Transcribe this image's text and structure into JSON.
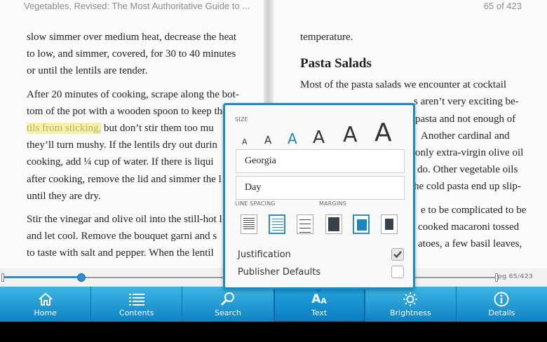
{
  "header": {
    "book_title": "Vegetables, Revised: The Most Authoritative Guide to ...",
    "page_of": "65 of 423"
  },
  "left_page": {
    "lines": [
      "slow simmer over medium heat, decrease the heat",
      "to low, and simmer, covered, for 30 to 40 minutes",
      "or until the lentils are tender.",
      "After 20 minutes of cooking, scrape along the bot-",
      "tom of the pot with a wooden spoon to keep the",
      "but don’t stir them too mu",
      "they’ll turn mushy. If the lentils dry out durin",
      "cooking, add ¼ cup of water. If there is liqui",
      "after cooking, remove the lid and simmer the l",
      "until they are dry.",
      "Stir the vinegar and olive oil into the still-hot l",
      "and let cool. Remove the bouquet garni and s",
      "to taste with salt and pepper. When the lentil"
    ],
    "highlight": "tils from sticking,"
  },
  "right_page": {
    "line1": "temperature.",
    "heading": "Pasta Salads",
    "lines": [
      "Most of the pasta salads we encounter at cocktail",
      "s aren’t very exciting be-",
      "pasta and not enough of",
      "Another cardinal and",
      "only extra-virgin olive oil",
      "do. Other vegetable oils",
      "he cold pasta end up slip-",
      "e to be complicated to be",
      "cooked macaroni tossed",
      "atoes, a few basil leaves,"
    ]
  },
  "progress": {
    "label": "pg 65/423",
    "fraction": 0.155
  },
  "popup": {
    "size_label": "SIZE",
    "size_glyphs": [
      "A",
      "A",
      "A",
      "A",
      "A",
      "A"
    ],
    "selected_size_index": 2,
    "font_value": "Georgia",
    "theme_value": "Day",
    "line_spacing_label": "LINE SPACING",
    "margins_label": "MARGINS",
    "selected_spacing_index": 1,
    "selected_margin_index": 1,
    "justification_label": "Justification",
    "justification_checked": true,
    "publisher_defaults_label": "Publisher Defaults",
    "publisher_defaults_checked": false
  },
  "toolbar": {
    "items": [
      {
        "label": "Home",
        "icon": "home-icon"
      },
      {
        "label": "Contents",
        "icon": "list-icon"
      },
      {
        "label": "Search",
        "icon": "search-icon"
      },
      {
        "label": "Text",
        "icon": "text-size-icon"
      },
      {
        "label": "Brightness",
        "icon": "sun-icon"
      },
      {
        "label": "Details",
        "icon": "info-icon"
      }
    ],
    "active_index": 3
  },
  "colors": {
    "accent": "#1a86c1",
    "toolbar": "#1e98d6",
    "highlight": "#f7f1a6"
  }
}
